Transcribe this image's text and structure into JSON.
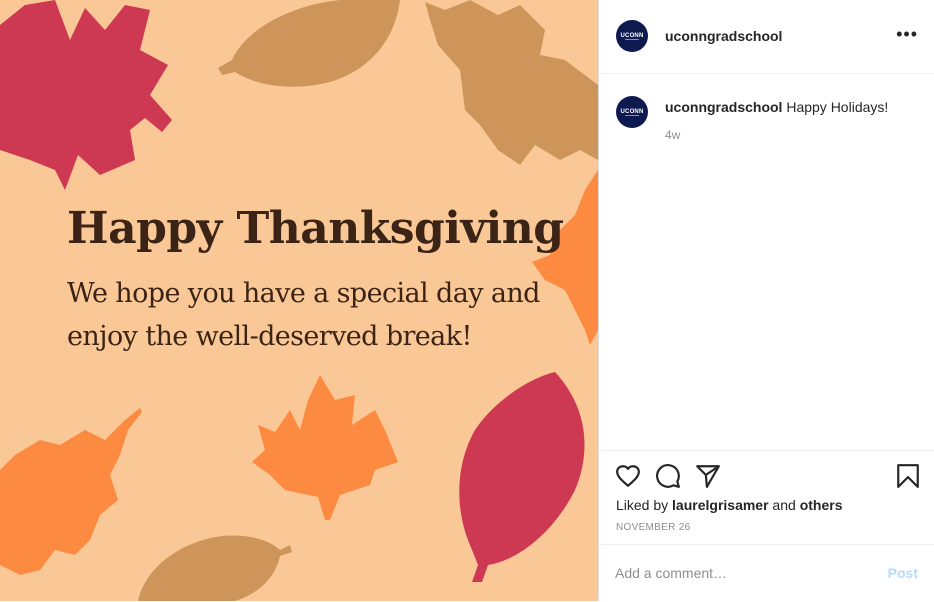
{
  "colors": {
    "background": "#fac896",
    "text_dark": "#3b2416",
    "leaf_red": "#cd3852",
    "leaf_tan": "#cd955a",
    "leaf_orange": "#fc8a40",
    "post_link": "#b3dbff"
  },
  "image": {
    "title": "Happy Thanksgiving",
    "subtitle": "We hope you have a special day and enjoy the well-deserved break!"
  },
  "post": {
    "username": "uconngradschool",
    "avatar_text": "UCONN",
    "more_icon": "more-horizontal-icon",
    "caption_text": " Happy Holidays!",
    "time_ago": "4w",
    "liked_prefix": "Liked by ",
    "liked_user": "laurelgrisamer",
    "liked_and": " and ",
    "liked_others": "others",
    "date": "NOVEMBER 26"
  },
  "actions": {
    "icons": [
      "heart-icon",
      "comment-icon",
      "share-icon",
      "bookmark-icon"
    ]
  },
  "comment": {
    "placeholder": "Add a comment…",
    "post_label": "Post"
  }
}
